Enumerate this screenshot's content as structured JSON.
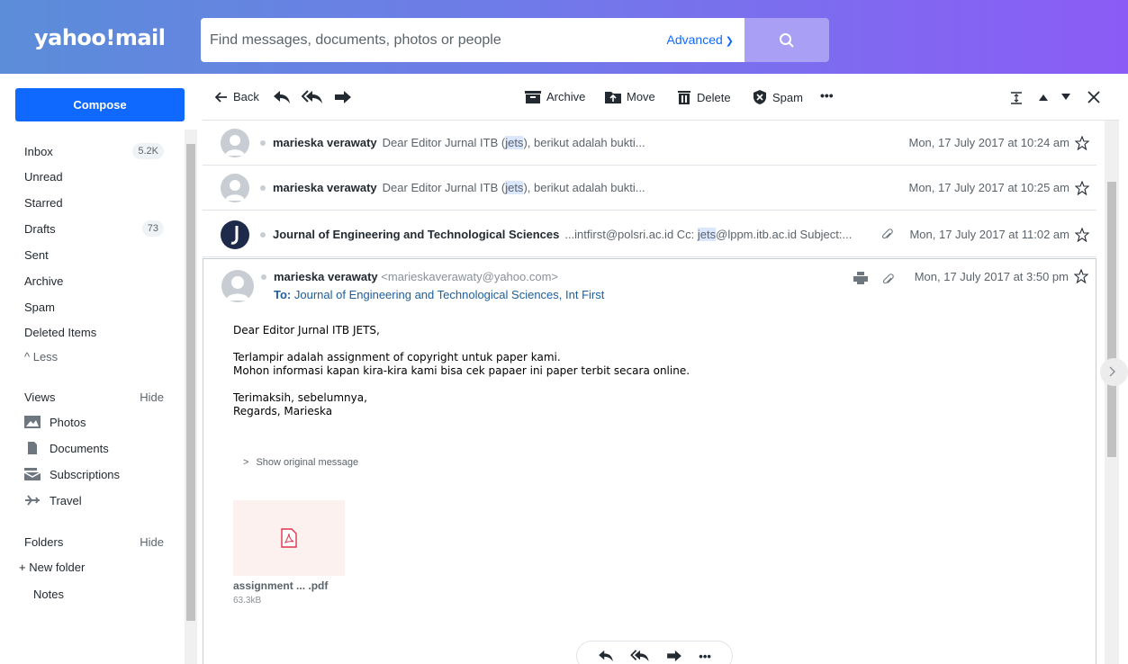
{
  "header": {
    "logo": "yahoo!mail",
    "search_placeholder": "Find messages, documents, photos or people",
    "advanced_label": "Advanced"
  },
  "sidebar": {
    "compose_label": "Compose",
    "folders": [
      {
        "label": "Inbox",
        "badge": "5.2K"
      },
      {
        "label": "Unread"
      },
      {
        "label": "Starred"
      },
      {
        "label": "Drafts",
        "badge": "73"
      },
      {
        "label": "Sent"
      },
      {
        "label": "Archive"
      },
      {
        "label": "Spam"
      },
      {
        "label": "Deleted Items"
      },
      {
        "label": "^ Less"
      }
    ],
    "views_label": "Views",
    "views_hide": "Hide",
    "views": [
      "Photos",
      "Documents",
      "Subscriptions",
      "Travel"
    ],
    "folders_label": "Folders",
    "folders_hide": "Hide",
    "new_folder": "+ New folder",
    "notes": "Notes"
  },
  "toolbar": {
    "back": "Back",
    "archive": "Archive",
    "move": "Move",
    "delete": "Delete",
    "spam": "Spam",
    "more": "•••"
  },
  "messages": [
    {
      "sender": "marieska verawaty",
      "snippet_pre": "Dear Editor Jurnal ITB (",
      "snippet_hl": "jets",
      "snippet_post": "), berikut adalah bukti...",
      "date": "Mon, 17 July 2017 at 10:24 am"
    },
    {
      "sender": "marieska verawaty",
      "snippet_pre": "Dear Editor Jurnal ITB (",
      "snippet_hl": "jets",
      "snippet_post": "), berikut adalah bukti...",
      "date": "Mon, 17 July 2017 at 10:25 am"
    },
    {
      "sender": "Journal of Engineering and Technological Sciences",
      "snippet_pre": "...intfirst@polsri.ac.id Cc: ",
      "snippet_hl": "jets",
      "snippet_post": "@lppm.itb.ac.id Subject:...",
      "date": "Mon, 17 July 2017 at 11:02 am"
    }
  ],
  "open_message": {
    "sender": "marieska verawaty",
    "email": "<marieskaverawaty@yahoo.com>",
    "to_label": "To:",
    "to_value": "Journal of Engineering and Technological Sciences,  Int First",
    "date": "Mon, 17 July 2017 at 3:50 pm",
    "body_greeting": " Dear Editor Jurnal ITB JETS,",
    "body_line1": "Terlampir adalah assignment of copyright untuk paper kami.",
    "body_line2": "Mohon informasi kapan kira-kira kami bisa cek papaer ini paper terbit secara online.",
    "body_thanks": "Terimaksih, sebelumnya,",
    "body_regards": "Regards, Marieska",
    "show_original": "Show original message",
    "attachment_name": "assignment ... .pdf",
    "attachment_size": "63.3kB",
    "reply_more": "•••"
  },
  "colors": {
    "accent": "#0f69ff",
    "header_start": "#5b8dd9",
    "header_end": "#8b5cf6"
  }
}
